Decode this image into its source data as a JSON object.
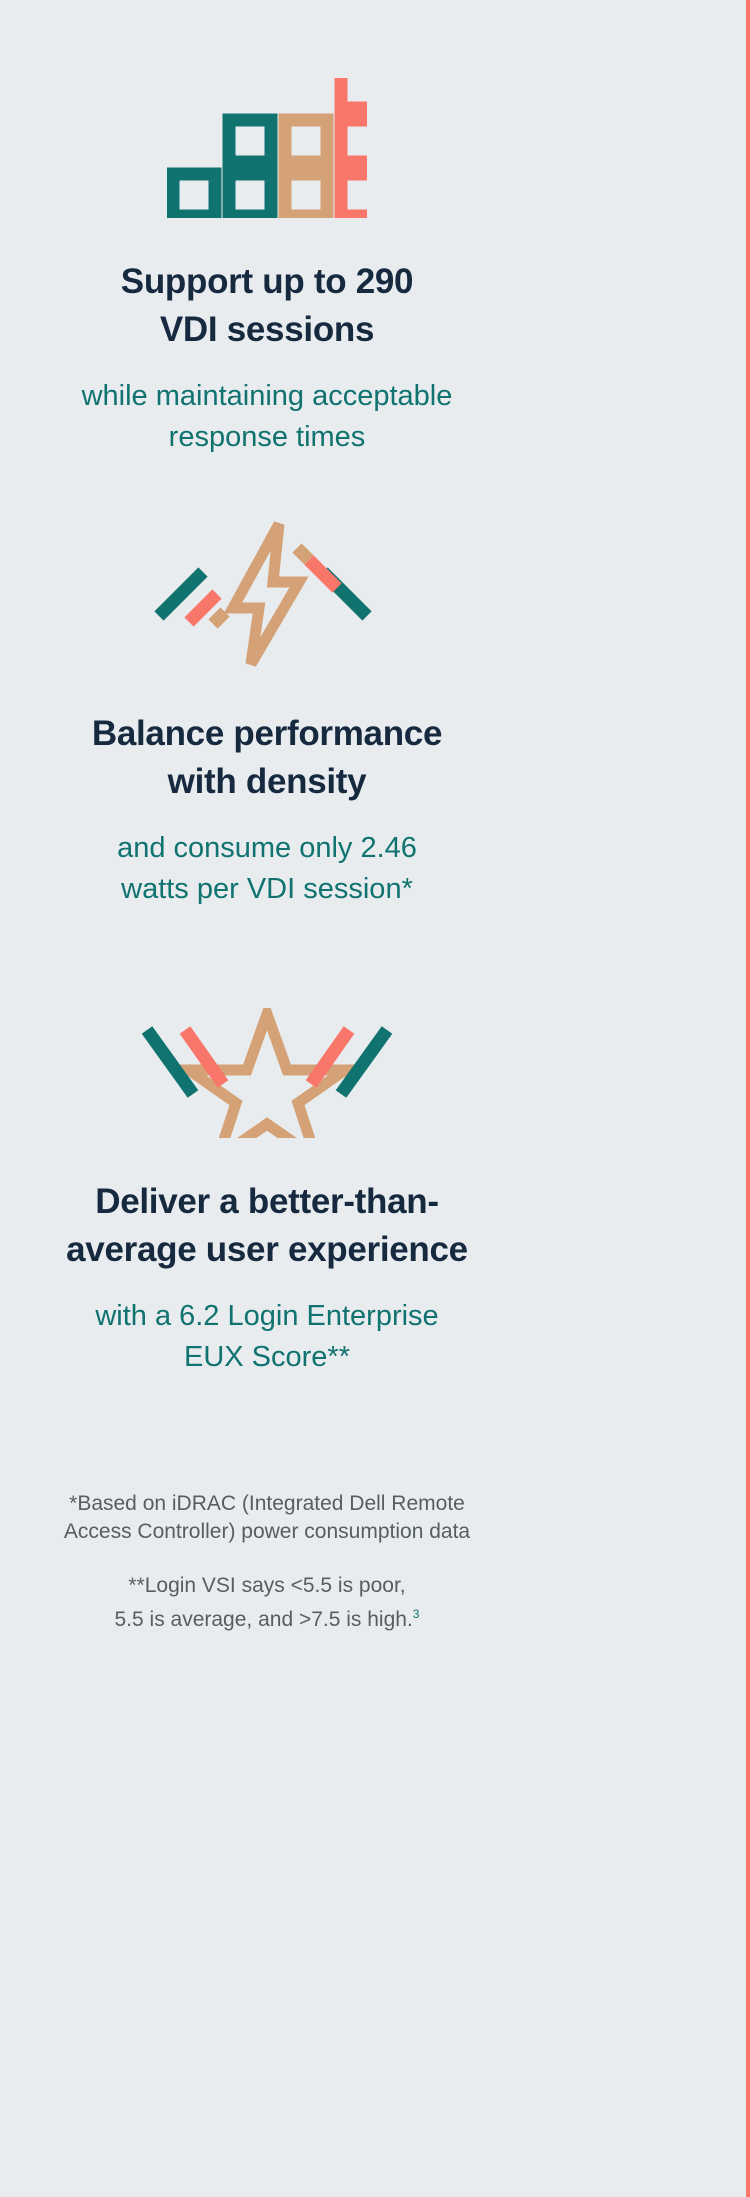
{
  "page": {
    "background_color": "#e8ecef",
    "edge_rule_color": "#f9766a",
    "heading_color": "#16293f",
    "subheading_color": "#107370",
    "footnote_color": "#565e63",
    "accent_teal": "#107370",
    "accent_tan": "#d4a276",
    "accent_coral": "#f9766a"
  },
  "sections": [
    {
      "icon_name": "bar-chart-squares-icon",
      "headline": "Support up to 290 VDI sessions",
      "headline_lines": [
        "Support up to 290",
        "VDI sessions"
      ],
      "subline": "while maintaining acceptable response times",
      "subline_lines": [
        "while maintaining acceptable",
        "response times"
      ]
    },
    {
      "icon_name": "lightning-bolt-speed-icon",
      "headline": "Balance performance with density",
      "headline_lines": [
        "Balance performance",
        "with density"
      ],
      "subline": "and consume only 2.46 watts per VDI session*",
      "subline_lines": [
        "and consume only 2.46",
        "watts per VDI session*"
      ]
    },
    {
      "icon_name": "star-speed-icon",
      "headline": "Deliver a better-than-average user experience",
      "headline_lines": [
        "Deliver a better-than-",
        "average user experience"
      ],
      "subline": "with a 6.2 Login Enterprise EUX Score**",
      "subline_lines": [
        "with a 6.2 Login Enterprise",
        "EUX Score**"
      ]
    }
  ],
  "footnotes": {
    "first_lines": [
      "*Based on iDRAC (Integrated Dell Remote",
      "Access Controller) power consumption data"
    ],
    "second_lines": [
      "**Login VSI says <5.5 is poor,",
      "5.5 is average, and >7.5 is high."
    ],
    "second_superscript": "3"
  }
}
